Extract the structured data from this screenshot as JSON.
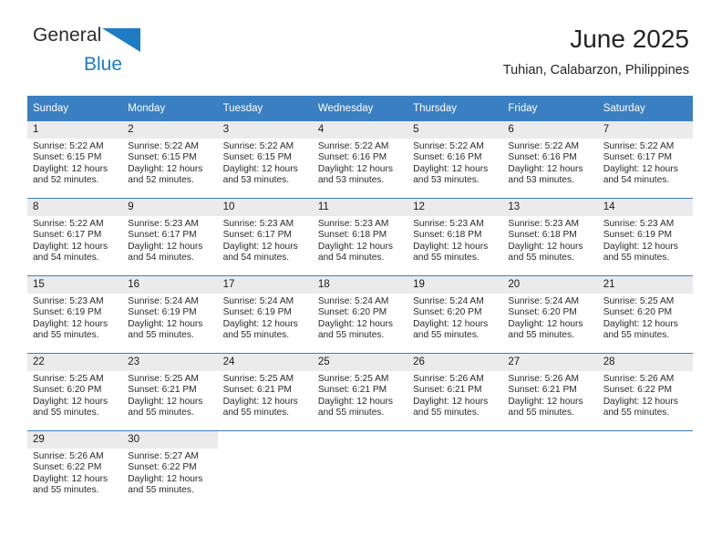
{
  "brand": {
    "name_top": "General",
    "name_bottom": "Blue",
    "triangle_icon": "triangle-icon",
    "colors": {
      "dark": "#2b2b2b",
      "blue": "#1d7cc4"
    }
  },
  "header": {
    "title": "June 2025",
    "subtitle": "Tuhian, Calabarzon, Philippines"
  },
  "theme": {
    "header_blue": "#3a7fc1",
    "daynum_band": "#ebebeb",
    "text": "#1a1a1a"
  },
  "weekdays": [
    "Sunday",
    "Monday",
    "Tuesday",
    "Wednesday",
    "Thursday",
    "Friday",
    "Saturday"
  ],
  "weeks": [
    [
      {
        "day": "1",
        "sunrise": "Sunrise: 5:22 AM",
        "sunset": "Sunset: 6:15 PM",
        "daylight": "Daylight: 12 hours and 52 minutes."
      },
      {
        "day": "2",
        "sunrise": "Sunrise: 5:22 AM",
        "sunset": "Sunset: 6:15 PM",
        "daylight": "Daylight: 12 hours and 52 minutes."
      },
      {
        "day": "3",
        "sunrise": "Sunrise: 5:22 AM",
        "sunset": "Sunset: 6:15 PM",
        "daylight": "Daylight: 12 hours and 53 minutes."
      },
      {
        "day": "4",
        "sunrise": "Sunrise: 5:22 AM",
        "sunset": "Sunset: 6:16 PM",
        "daylight": "Daylight: 12 hours and 53 minutes."
      },
      {
        "day": "5",
        "sunrise": "Sunrise: 5:22 AM",
        "sunset": "Sunset: 6:16 PM",
        "daylight": "Daylight: 12 hours and 53 minutes."
      },
      {
        "day": "6",
        "sunrise": "Sunrise: 5:22 AM",
        "sunset": "Sunset: 6:16 PM",
        "daylight": "Daylight: 12 hours and 53 minutes."
      },
      {
        "day": "7",
        "sunrise": "Sunrise: 5:22 AM",
        "sunset": "Sunset: 6:17 PM",
        "daylight": "Daylight: 12 hours and 54 minutes."
      }
    ],
    [
      {
        "day": "8",
        "sunrise": "Sunrise: 5:22 AM",
        "sunset": "Sunset: 6:17 PM",
        "daylight": "Daylight: 12 hours and 54 minutes."
      },
      {
        "day": "9",
        "sunrise": "Sunrise: 5:23 AM",
        "sunset": "Sunset: 6:17 PM",
        "daylight": "Daylight: 12 hours and 54 minutes."
      },
      {
        "day": "10",
        "sunrise": "Sunrise: 5:23 AM",
        "sunset": "Sunset: 6:17 PM",
        "daylight": "Daylight: 12 hours and 54 minutes."
      },
      {
        "day": "11",
        "sunrise": "Sunrise: 5:23 AM",
        "sunset": "Sunset: 6:18 PM",
        "daylight": "Daylight: 12 hours and 54 minutes."
      },
      {
        "day": "12",
        "sunrise": "Sunrise: 5:23 AM",
        "sunset": "Sunset: 6:18 PM",
        "daylight": "Daylight: 12 hours and 55 minutes."
      },
      {
        "day": "13",
        "sunrise": "Sunrise: 5:23 AM",
        "sunset": "Sunset: 6:18 PM",
        "daylight": "Daylight: 12 hours and 55 minutes."
      },
      {
        "day": "14",
        "sunrise": "Sunrise: 5:23 AM",
        "sunset": "Sunset: 6:19 PM",
        "daylight": "Daylight: 12 hours and 55 minutes."
      }
    ],
    [
      {
        "day": "15",
        "sunrise": "Sunrise: 5:23 AM",
        "sunset": "Sunset: 6:19 PM",
        "daylight": "Daylight: 12 hours and 55 minutes."
      },
      {
        "day": "16",
        "sunrise": "Sunrise: 5:24 AM",
        "sunset": "Sunset: 6:19 PM",
        "daylight": "Daylight: 12 hours and 55 minutes."
      },
      {
        "day": "17",
        "sunrise": "Sunrise: 5:24 AM",
        "sunset": "Sunset: 6:19 PM",
        "daylight": "Daylight: 12 hours and 55 minutes."
      },
      {
        "day": "18",
        "sunrise": "Sunrise: 5:24 AM",
        "sunset": "Sunset: 6:20 PM",
        "daylight": "Daylight: 12 hours and 55 minutes."
      },
      {
        "day": "19",
        "sunrise": "Sunrise: 5:24 AM",
        "sunset": "Sunset: 6:20 PM",
        "daylight": "Daylight: 12 hours and 55 minutes."
      },
      {
        "day": "20",
        "sunrise": "Sunrise: 5:24 AM",
        "sunset": "Sunset: 6:20 PM",
        "daylight": "Daylight: 12 hours and 55 minutes."
      },
      {
        "day": "21",
        "sunrise": "Sunrise: 5:25 AM",
        "sunset": "Sunset: 6:20 PM",
        "daylight": "Daylight: 12 hours and 55 minutes."
      }
    ],
    [
      {
        "day": "22",
        "sunrise": "Sunrise: 5:25 AM",
        "sunset": "Sunset: 6:20 PM",
        "daylight": "Daylight: 12 hours and 55 minutes."
      },
      {
        "day": "23",
        "sunrise": "Sunrise: 5:25 AM",
        "sunset": "Sunset: 6:21 PM",
        "daylight": "Daylight: 12 hours and 55 minutes."
      },
      {
        "day": "24",
        "sunrise": "Sunrise: 5:25 AM",
        "sunset": "Sunset: 6:21 PM",
        "daylight": "Daylight: 12 hours and 55 minutes."
      },
      {
        "day": "25",
        "sunrise": "Sunrise: 5:25 AM",
        "sunset": "Sunset: 6:21 PM",
        "daylight": "Daylight: 12 hours and 55 minutes."
      },
      {
        "day": "26",
        "sunrise": "Sunrise: 5:26 AM",
        "sunset": "Sunset: 6:21 PM",
        "daylight": "Daylight: 12 hours and 55 minutes."
      },
      {
        "day": "27",
        "sunrise": "Sunrise: 5:26 AM",
        "sunset": "Sunset: 6:21 PM",
        "daylight": "Daylight: 12 hours and 55 minutes."
      },
      {
        "day": "28",
        "sunrise": "Sunrise: 5:26 AM",
        "sunset": "Sunset: 6:22 PM",
        "daylight": "Daylight: 12 hours and 55 minutes."
      }
    ],
    [
      {
        "day": "29",
        "sunrise": "Sunrise: 5:26 AM",
        "sunset": "Sunset: 6:22 PM",
        "daylight": "Daylight: 12 hours and 55 minutes."
      },
      {
        "day": "30",
        "sunrise": "Sunrise: 5:27 AM",
        "sunset": "Sunset: 6:22 PM",
        "daylight": "Daylight: 12 hours and 55 minutes."
      },
      {
        "day": "",
        "sunrise": "",
        "sunset": "",
        "daylight": ""
      },
      {
        "day": "",
        "sunrise": "",
        "sunset": "",
        "daylight": ""
      },
      {
        "day": "",
        "sunrise": "",
        "sunset": "",
        "daylight": ""
      },
      {
        "day": "",
        "sunrise": "",
        "sunset": "",
        "daylight": ""
      },
      {
        "day": "",
        "sunrise": "",
        "sunset": "",
        "daylight": ""
      }
    ]
  ]
}
